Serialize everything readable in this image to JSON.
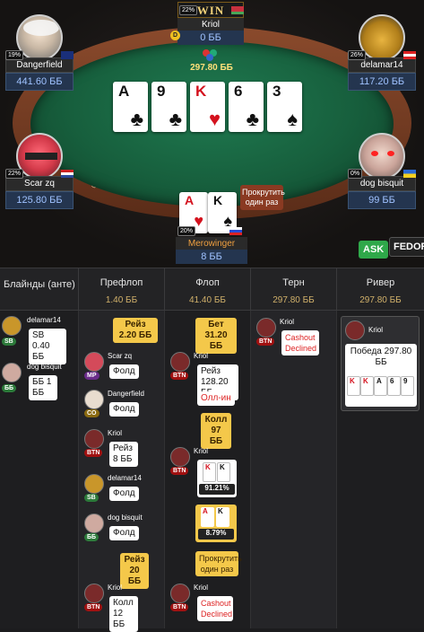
{
  "table": {
    "rail_letters": "U S",
    "win_label": "WIN",
    "pot_top": "0 ББ",
    "pot_center": "297.80 ББ",
    "board": [
      {
        "rank": "A",
        "suit": "♣",
        "red": false
      },
      {
        "rank": "9",
        "suit": "♣",
        "red": false
      },
      {
        "rank": "K",
        "suit": "♥",
        "red": true
      },
      {
        "rank": "6",
        "suit": "♣",
        "red": false
      },
      {
        "rank": "3",
        "suit": "♠",
        "red": false
      }
    ],
    "run_it_once": "Прокрутить один раз",
    "ask_label": "ASK",
    "fedor_label": "FEDOR"
  },
  "players": {
    "kriol": {
      "name": "Kriol",
      "stack": "0 ББ",
      "pct": "22%"
    },
    "dangerfield": {
      "name": "Dangerfield",
      "stack": "441.60 ББ",
      "pct": "19%"
    },
    "delamar": {
      "name": "delamar14",
      "stack": "117.20 ББ",
      "pct": "26%"
    },
    "scar": {
      "name": "Scar zq",
      "stack": "125.80 ББ",
      "pct": "22%"
    },
    "dog": {
      "name": "dog bisquit",
      "stack": "99 ББ",
      "pct": "0%"
    },
    "merowinger": {
      "name": "Merowinger",
      "stack": "8 ББ",
      "pct": "20%",
      "cards": [
        {
          "rank": "A",
          "suit": "♥",
          "red": true
        },
        {
          "rank": "K",
          "suit": "♠",
          "red": false
        }
      ]
    }
  },
  "streets": [
    {
      "title": "Блайнды (анте)",
      "pot": "1.40 ББ"
    },
    {
      "title": "Префлоп",
      "pot": "1.40 ББ"
    },
    {
      "title": "Флоп",
      "pot": "41.40 ББ"
    },
    {
      "title": "Терн",
      "pot": "297.80 ББ"
    },
    {
      "title": "Ривер",
      "pot": "297.80 ББ"
    }
  ],
  "blinds": [
    {
      "name": "delamar14",
      "pos": "SB",
      "action": "SB 0.40 ББ"
    },
    {
      "name": "dog bisquit",
      "pos": "ББ",
      "action": "ББ 1 ББ"
    }
  ],
  "preflop": [
    {
      "action": "Рейз 2.20 ББ"
    },
    {
      "name": "Scar zq",
      "pos": "MP",
      "action": "Фолд"
    },
    {
      "name": "Dangerfield",
      "pos": "CO",
      "action": "Фолд"
    },
    {
      "name": "Kriol",
      "pos": "BTN",
      "action": "Рейз 8 ББ"
    },
    {
      "name": "delamar14",
      "pos": "SB",
      "action": "Фолд"
    },
    {
      "name": "dog bisquit",
      "pos": "ББ",
      "action": "Фолд"
    },
    {
      "action": "Рейз 20 ББ"
    },
    {
      "name": "Kriol",
      "pos": "BTN",
      "action": "Колл 12 ББ"
    }
  ],
  "flop": {
    "bet": "Бет 31.20 ББ",
    "raise_name": "Kriol",
    "raise_pos": "BTN",
    "raise": "Рейз 128.20 ББ",
    "allin": "Олл-ин",
    "call": "Колл 97 ББ",
    "show_name": "Kriol",
    "show_pos": "BTN",
    "kriol_cards": [
      {
        "rank": "K",
        "red": true
      },
      {
        "rank": "K",
        "red": false
      }
    ],
    "kriol_eq": "91.21%",
    "hero_cards": [
      {
        "rank": "A",
        "red": true
      },
      {
        "rank": "K",
        "red": false
      }
    ],
    "hero_eq": "8.79%",
    "run_once": "Прокрутить один раз",
    "cashout_name": "Kriol",
    "cashout_pos": "BTN",
    "cashout": "Cashout Declined"
  },
  "turn": {
    "name": "Kriol",
    "pos": "BTN",
    "cashout": "Cashout Declined"
  },
  "river": {
    "name": "Kriol",
    "win_text": "Победа 297.80 ББ",
    "cards": [
      {
        "rank": "K",
        "red": true
      },
      {
        "rank": "K",
        "red": true
      },
      {
        "rank": "A",
        "red": false
      },
      {
        "rank": "6",
        "red": false
      },
      {
        "rank": "9",
        "red": false
      }
    ]
  },
  "colors": {
    "sb": "#2c7a3a",
    "bb": "#2c7a3a",
    "btn": "#a01010",
    "mp": "#6a2c8a",
    "co": "#8a6a10"
  }
}
